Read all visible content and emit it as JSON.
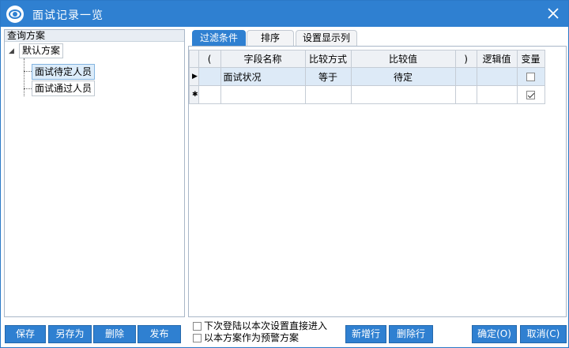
{
  "window": {
    "title": "面试记录一览",
    "icon": "eye-icon",
    "close_icon": "close-icon",
    "accent_color": "#2f80d1"
  },
  "left_pane": {
    "header": "查询方案",
    "tree": {
      "root_label": "默认方案",
      "root_expanded": true,
      "children": [
        {
          "label": "面试待定人员",
          "selected": true
        },
        {
          "label": "面试通过人员",
          "selected": false
        }
      ]
    }
  },
  "tabs": [
    {
      "label": "过滤条件",
      "active": true
    },
    {
      "label": "排序",
      "active": false
    },
    {
      "label": "设置显示列",
      "active": false
    }
  ],
  "grid": {
    "columns": [
      "(",
      "字段名称",
      "比较方式",
      "比较值",
      ")",
      "逻辑值",
      "变量"
    ],
    "rows": [
      {
        "indicator": "▶",
        "open_paren": "",
        "field": "面试状况",
        "operator": "等于",
        "value": "待定",
        "close_paren": "",
        "logic": "",
        "variable_checked": false
      },
      {
        "indicator": "✱",
        "open_paren": "",
        "field": "",
        "operator": "",
        "value": "",
        "close_paren": "",
        "logic": "",
        "variable_checked": true
      }
    ]
  },
  "options": {
    "next_login_direct": {
      "label": "下次登陆以本次设置直接进入",
      "checked": false
    },
    "as_warning_scheme": {
      "label": "以本方案作为预警方案",
      "checked": false
    }
  },
  "buttons": {
    "save": "保存",
    "save_as": "另存为",
    "delete": "删除",
    "publish": "发布",
    "add_row": "新增行",
    "delete_row": "删除行",
    "ok": "确定(O)",
    "cancel": "取消(C)"
  }
}
